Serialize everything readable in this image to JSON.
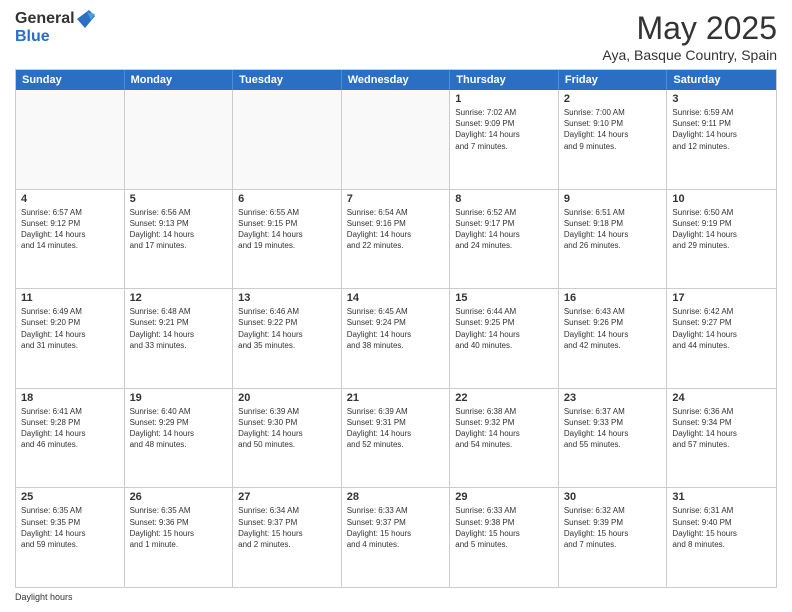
{
  "header": {
    "logo_general": "General",
    "logo_blue": "Blue",
    "title": "May 2025",
    "subtitle": "Aya, Basque Country, Spain"
  },
  "days_of_week": [
    "Sunday",
    "Monday",
    "Tuesday",
    "Wednesday",
    "Thursday",
    "Friday",
    "Saturday"
  ],
  "weeks": [
    [
      {
        "day": "",
        "empty": true
      },
      {
        "day": "",
        "empty": true
      },
      {
        "day": "",
        "empty": true
      },
      {
        "day": "",
        "empty": true
      },
      {
        "day": "1",
        "info": "Sunrise: 7:02 AM\nSunset: 9:09 PM\nDaylight: 14 hours\nand 7 minutes."
      },
      {
        "day": "2",
        "info": "Sunrise: 7:00 AM\nSunset: 9:10 PM\nDaylight: 14 hours\nand 9 minutes."
      },
      {
        "day": "3",
        "info": "Sunrise: 6:59 AM\nSunset: 9:11 PM\nDaylight: 14 hours\nand 12 minutes."
      }
    ],
    [
      {
        "day": "4",
        "info": "Sunrise: 6:57 AM\nSunset: 9:12 PM\nDaylight: 14 hours\nand 14 minutes."
      },
      {
        "day": "5",
        "info": "Sunrise: 6:56 AM\nSunset: 9:13 PM\nDaylight: 14 hours\nand 17 minutes."
      },
      {
        "day": "6",
        "info": "Sunrise: 6:55 AM\nSunset: 9:15 PM\nDaylight: 14 hours\nand 19 minutes."
      },
      {
        "day": "7",
        "info": "Sunrise: 6:54 AM\nSunset: 9:16 PM\nDaylight: 14 hours\nand 22 minutes."
      },
      {
        "day": "8",
        "info": "Sunrise: 6:52 AM\nSunset: 9:17 PM\nDaylight: 14 hours\nand 24 minutes."
      },
      {
        "day": "9",
        "info": "Sunrise: 6:51 AM\nSunset: 9:18 PM\nDaylight: 14 hours\nand 26 minutes."
      },
      {
        "day": "10",
        "info": "Sunrise: 6:50 AM\nSunset: 9:19 PM\nDaylight: 14 hours\nand 29 minutes."
      }
    ],
    [
      {
        "day": "11",
        "info": "Sunrise: 6:49 AM\nSunset: 9:20 PM\nDaylight: 14 hours\nand 31 minutes."
      },
      {
        "day": "12",
        "info": "Sunrise: 6:48 AM\nSunset: 9:21 PM\nDaylight: 14 hours\nand 33 minutes."
      },
      {
        "day": "13",
        "info": "Sunrise: 6:46 AM\nSunset: 9:22 PM\nDaylight: 14 hours\nand 35 minutes."
      },
      {
        "day": "14",
        "info": "Sunrise: 6:45 AM\nSunset: 9:24 PM\nDaylight: 14 hours\nand 38 minutes."
      },
      {
        "day": "15",
        "info": "Sunrise: 6:44 AM\nSunset: 9:25 PM\nDaylight: 14 hours\nand 40 minutes."
      },
      {
        "day": "16",
        "info": "Sunrise: 6:43 AM\nSunset: 9:26 PM\nDaylight: 14 hours\nand 42 minutes."
      },
      {
        "day": "17",
        "info": "Sunrise: 6:42 AM\nSunset: 9:27 PM\nDaylight: 14 hours\nand 44 minutes."
      }
    ],
    [
      {
        "day": "18",
        "info": "Sunrise: 6:41 AM\nSunset: 9:28 PM\nDaylight: 14 hours\nand 46 minutes."
      },
      {
        "day": "19",
        "info": "Sunrise: 6:40 AM\nSunset: 9:29 PM\nDaylight: 14 hours\nand 48 minutes."
      },
      {
        "day": "20",
        "info": "Sunrise: 6:39 AM\nSunset: 9:30 PM\nDaylight: 14 hours\nand 50 minutes."
      },
      {
        "day": "21",
        "info": "Sunrise: 6:39 AM\nSunset: 9:31 PM\nDaylight: 14 hours\nand 52 minutes."
      },
      {
        "day": "22",
        "info": "Sunrise: 6:38 AM\nSunset: 9:32 PM\nDaylight: 14 hours\nand 54 minutes."
      },
      {
        "day": "23",
        "info": "Sunrise: 6:37 AM\nSunset: 9:33 PM\nDaylight: 14 hours\nand 55 minutes."
      },
      {
        "day": "24",
        "info": "Sunrise: 6:36 AM\nSunset: 9:34 PM\nDaylight: 14 hours\nand 57 minutes."
      }
    ],
    [
      {
        "day": "25",
        "info": "Sunrise: 6:35 AM\nSunset: 9:35 PM\nDaylight: 14 hours\nand 59 minutes."
      },
      {
        "day": "26",
        "info": "Sunrise: 6:35 AM\nSunset: 9:36 PM\nDaylight: 15 hours\nand 1 minute."
      },
      {
        "day": "27",
        "info": "Sunrise: 6:34 AM\nSunset: 9:37 PM\nDaylight: 15 hours\nand 2 minutes."
      },
      {
        "day": "28",
        "info": "Sunrise: 6:33 AM\nSunset: 9:37 PM\nDaylight: 15 hours\nand 4 minutes."
      },
      {
        "day": "29",
        "info": "Sunrise: 6:33 AM\nSunset: 9:38 PM\nDaylight: 15 hours\nand 5 minutes."
      },
      {
        "day": "30",
        "info": "Sunrise: 6:32 AM\nSunset: 9:39 PM\nDaylight: 15 hours\nand 7 minutes."
      },
      {
        "day": "31",
        "info": "Sunrise: 6:31 AM\nSunset: 9:40 PM\nDaylight: 15 hours\nand 8 minutes."
      }
    ]
  ],
  "footer": {
    "daylight_label": "Daylight hours"
  }
}
